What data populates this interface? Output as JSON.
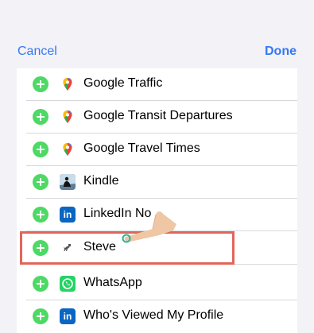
{
  "nav": {
    "cancel_label": "Cancel",
    "done_label": "Done"
  },
  "apps": [
    {
      "label": "Google Traffic",
      "icon": "google-maps-pin-icon"
    },
    {
      "label": "Google Transit Departures",
      "icon": "google-maps-pin-icon"
    },
    {
      "label": "Google Travel Times",
      "icon": "google-maps-pin-icon"
    },
    {
      "label": "Kindle",
      "icon": "kindle-icon"
    },
    {
      "label": "LinkedIn No",
      "icon": "linkedin-icon"
    },
    {
      "label": "Steve",
      "icon": "dinosaur-icon"
    },
    {
      "label": "WhatsApp",
      "icon": "whatsapp-icon"
    },
    {
      "label": "Who's Viewed My Profile",
      "icon": "linkedin-icon"
    }
  ],
  "icons": {
    "linkedin_text": "in"
  },
  "colors": {
    "accent": "#3478f6",
    "add_button": "#4cd964",
    "highlight_border": "#e2655a"
  }
}
